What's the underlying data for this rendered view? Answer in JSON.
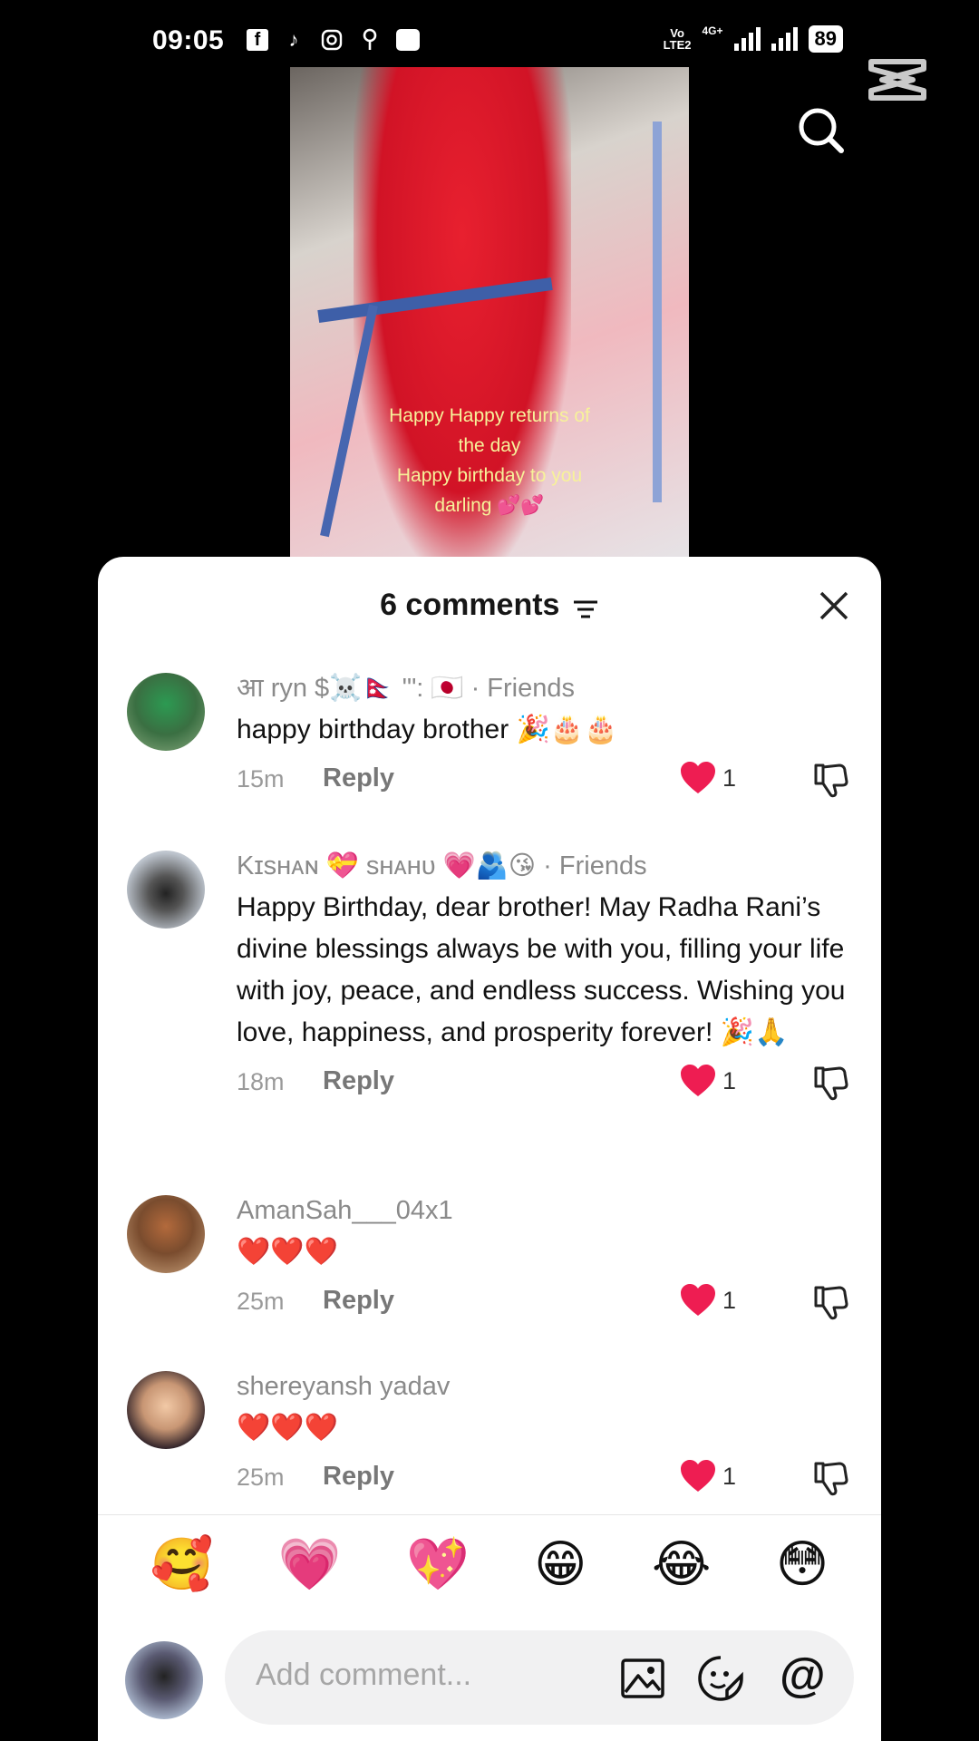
{
  "status_bar": {
    "time": "09:05",
    "network_top": "Vo",
    "network_bottom": "LTE2",
    "network_4g": "4G+",
    "battery": "89"
  },
  "video": {
    "caption_line1": "Happy Happy returns of",
    "caption_line2": "the day",
    "caption_line3": "Happy birthday to you",
    "caption_line4": "darling 💕💕"
  },
  "sheet": {
    "title": "6 comments"
  },
  "comments": [
    {
      "user": "आ ryn $☠️🇳🇵 '\":  🇯🇵",
      "tag": "· Friends",
      "text": "happy birthday brother 🎉🎂🎂",
      "time": "15m",
      "reply": "Reply",
      "likes": "1"
    },
    {
      "user": "Kɪsʜᴀɴ 💝 sʜᴀʜᴜ 💗🫂😘",
      "tag": "· Friends",
      "text": "Happy Birthday, dear brother! May Radha Rani’s divine blessings always be with you, filling your life with joy, peace, and endless success. Wishing you love, happiness, and prosperity forever! 🎉🙏",
      "time": "18m",
      "reply": "Reply",
      "likes": "1"
    },
    {
      "user": "AmanSah___04x1",
      "tag": "",
      "text": "❤️❤️❤️",
      "time": "25m",
      "reply": "Reply",
      "likes": "1"
    },
    {
      "user": "shereyansh yadav",
      "tag": "",
      "text": "❤️❤️❤️",
      "time": "25m",
      "reply": "Reply",
      "likes": "1"
    }
  ],
  "emoji_bar": [
    "🥰",
    "💗",
    "💖",
    "😁",
    "😂",
    "😳"
  ],
  "input": {
    "placeholder": "Add comment..."
  },
  "colors": {
    "heart": "#ee1d52",
    "sheet_bg": "#ffffff",
    "input_bg": "#f1f1f2"
  }
}
